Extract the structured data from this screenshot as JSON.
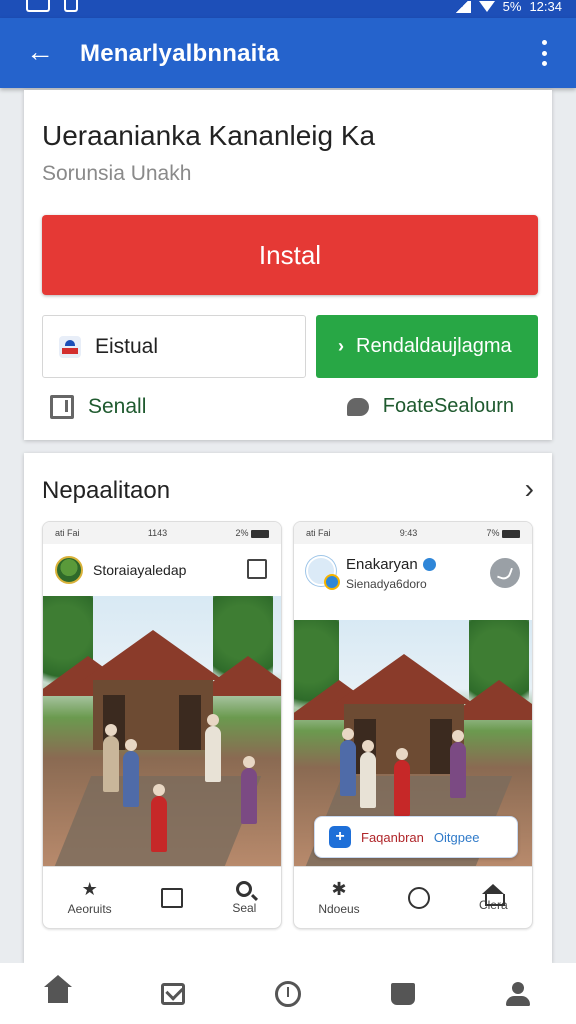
{
  "status_bar": {
    "signal_text": "5%",
    "time": "12:34"
  },
  "app_bar": {
    "title": "Menarlyalbnnaita"
  },
  "app": {
    "title": "Ueraanianka Kananleig Ka",
    "subtitle": "Sorunsia Unakh",
    "install_label": "Instal",
    "secondary_label": "Eistual",
    "primary_label": "Rendaldaujlagma",
    "action_left": "Senall",
    "action_right": "FoateSealourn"
  },
  "screenshots_section": {
    "title": "Nepaalitaon",
    "shot1": {
      "status_left": "ati Fai",
      "status_mid": "1143",
      "status_right": "2%",
      "name": "Storaiayaledap",
      "nav": [
        "Aeoruits",
        "",
        "Seal"
      ]
    },
    "shot2": {
      "status_left": "ati Fai",
      "status_mid": "9:43",
      "status_right": "7%",
      "name": "Enakaryan",
      "handle": "Sienadya6doro",
      "pill_red": "Faqanbran",
      "pill_blue": "Oitgpee",
      "nav": [
        "Ndoeus",
        "",
        "Clera"
      ]
    }
  },
  "bottom_nav": [
    "home-icon",
    "mail-icon",
    "clock-icon",
    "book-icon",
    "profile-icon"
  ]
}
